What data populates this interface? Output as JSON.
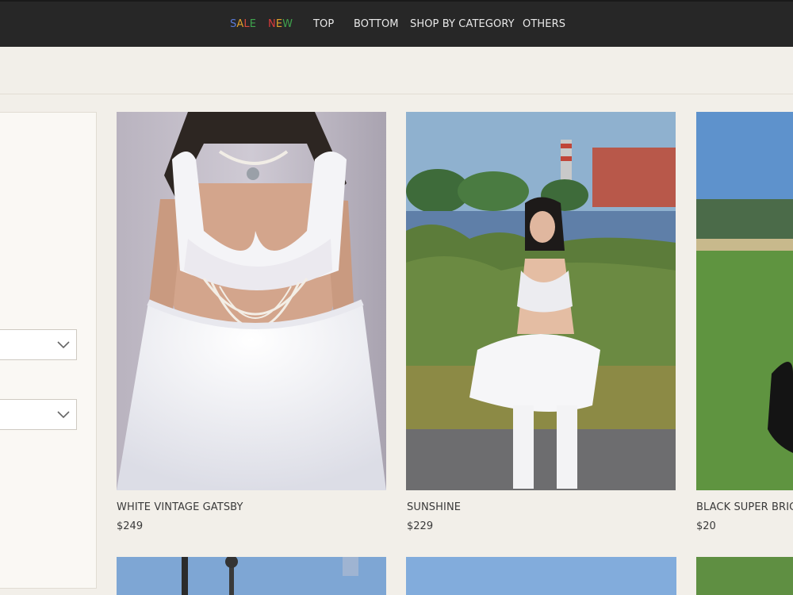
{
  "nav": {
    "sale_letters": [
      {
        "ch": "S",
        "color": "#5a7bd8"
      },
      {
        "ch": "A",
        "color": "#e0a12c"
      },
      {
        "ch": "L",
        "color": "#d94a3b"
      },
      {
        "ch": "E",
        "color": "#3fa34d"
      }
    ],
    "new_letters": [
      {
        "ch": "N",
        "color": "#d93a3a"
      },
      {
        "ch": "E",
        "color": "#e0a12c"
      },
      {
        "ch": "W",
        "color": "#3fa34d"
      }
    ],
    "items": [
      "TOP",
      "BOTTOM",
      "SHOP BY CATEGORY",
      "OTHERS"
    ]
  },
  "products": [
    {
      "name": "WHITE VINTAGE GATSBY",
      "price": "$249"
    },
    {
      "name": "SUNSHINE",
      "price": "$229"
    },
    {
      "name": "BLACK SUPER BRIG",
      "price": "$20"
    }
  ],
  "icons": {
    "select_chevron": "chevron-down-icon"
  }
}
